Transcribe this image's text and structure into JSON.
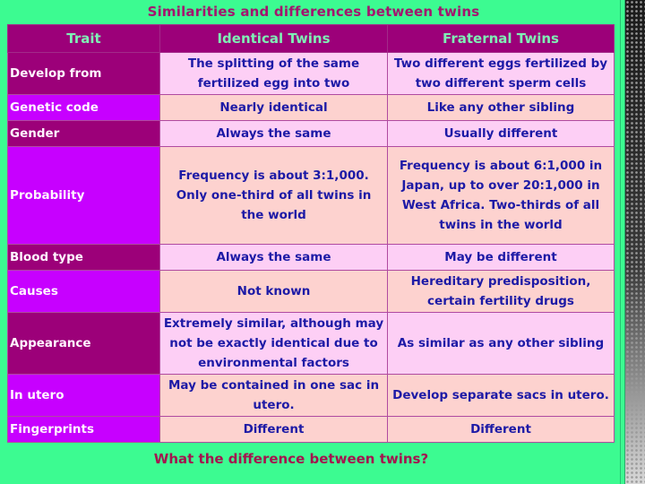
{
  "title": "Similarities and differences between twins",
  "footer": "What the difference between twins?",
  "table": {
    "headers": [
      "Trait",
      "Identical Twins",
      "Fraternal Twins"
    ],
    "rows": [
      {
        "trait": "Develop from",
        "identical": "The splitting of the same fertilized egg into two",
        "fraternal": "Two different eggs fertilized by two different sperm cells"
      },
      {
        "trait": "Genetic code",
        "identical": "Nearly identical",
        "fraternal": "Like any other sibling"
      },
      {
        "trait": "Gender",
        "identical": "Always the same",
        "fraternal": "Usually different"
      },
      {
        "trait": "Probability",
        "identical": "Frequency is about 3:1,000. Only one-third of all twins in the world",
        "fraternal": "Frequency is about 6:1,000 in Japan, up to over 20:1,000 in West Africa. Two-thirds of all twins in the world"
      },
      {
        "trait": "Blood type",
        "identical": "Always the same",
        "fraternal": "May be different"
      },
      {
        "trait": "Causes",
        "identical": "Not known",
        "fraternal": "Hereditary predisposition, certain fertility drugs"
      },
      {
        "trait": "Appearance",
        "identical": "Extremely similar, although may not be exactly identical due to environmental factors",
        "fraternal": "As similar as any other sibling"
      },
      {
        "trait": "In utero",
        "identical": "May be contained in one sac in utero.",
        "fraternal": "Develop separate sacs in utero."
      },
      {
        "trait": "Fingerprints",
        "identical": "Different",
        "fraternal": "Different"
      }
    ]
  },
  "colors": {
    "background": "#3cfb91",
    "header_bg": "#9c0079",
    "header_text": "#7ff0b5",
    "trait_dark": "#9c0079",
    "trait_bright": "#c700ff",
    "cell_pink": "#fdcff5",
    "cell_peach": "#fdd2cf",
    "cell_text": "#1d1aa6",
    "title_text": "#a3156f"
  }
}
